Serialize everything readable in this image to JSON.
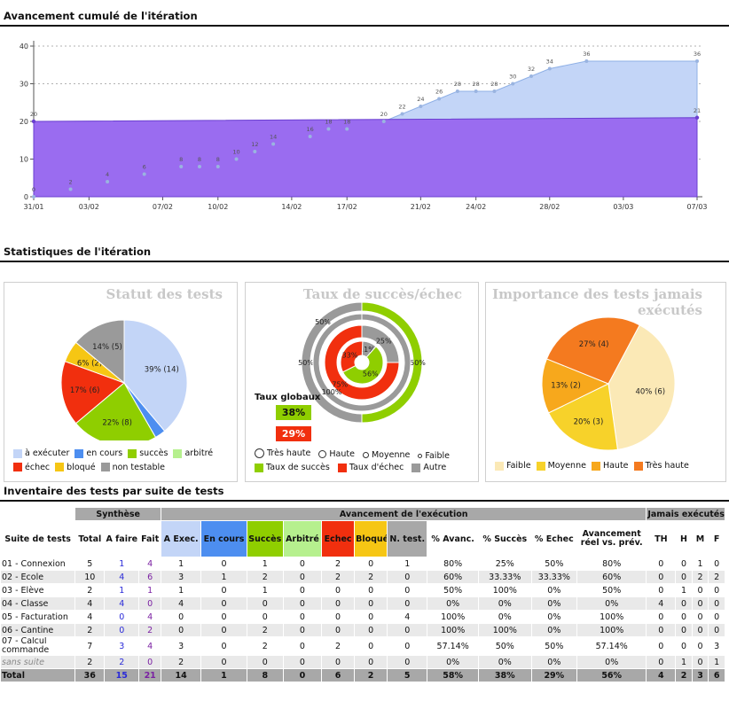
{
  "sections": {
    "cumulative_title": "Avancement cumulé de l'itération",
    "stats_title": "Statistiques de l'itération",
    "inventory_title": "Inventaire des tests par suite de tests"
  },
  "chart_data": [
    {
      "type": "area",
      "title": "Avancement cumulé de l'itération",
      "ylim": [
        0,
        40
      ],
      "yticks": [
        "0",
        "10",
        "20",
        "30",
        "40"
      ],
      "xticks": [
        "31/01",
        "03/02",
        "07/02",
        "10/02",
        "14/02",
        "17/02",
        "21/02",
        "24/02",
        "28/02",
        "03/03",
        "07/03"
      ],
      "grid": true,
      "colors": {
        "planned_fill": "#9a6cf0",
        "planned_line": "#6a3fd0",
        "actual_fill": "#c3d5f7",
        "actual_line": "#8fb0e6"
      },
      "series": [
        {
          "values": [
            {
              "x": "31/01",
              "y": 20
            },
            {
              "x": "07/03",
              "y": 21
            }
          ]
        },
        {
          "values": [
            {
              "x": "31/01",
              "y": 0
            },
            {
              "x": "02/02",
              "y": 2
            },
            {
              "x": "04/02",
              "y": 4
            },
            {
              "x": "06/02",
              "y": 6
            },
            {
              "x": "08/02",
              "y": 8
            },
            {
              "x": "09/02",
              "y": 8
            },
            {
              "x": "10/02",
              "y": 8
            },
            {
              "x": "11/02",
              "y": 10
            },
            {
              "x": "12/02",
              "y": 12
            },
            {
              "x": "13/02",
              "y": 14
            },
            {
              "x": "15/02",
              "y": 16
            },
            {
              "x": "16/02",
              "y": 18
            },
            {
              "x": "17/02",
              "y": 18
            },
            {
              "x": "19/02",
              "y": 20
            },
            {
              "x": "20/02",
              "y": 22
            },
            {
              "x": "21/02",
              "y": 24
            },
            {
              "x": "22/02",
              "y": 26
            },
            {
              "x": "23/02",
              "y": 28
            },
            {
              "x": "24/02",
              "y": 28
            },
            {
              "x": "25/02",
              "y": 28
            },
            {
              "x": "26/02",
              "y": 30
            },
            {
              "x": "27/02",
              "y": 32
            },
            {
              "x": "28/02",
              "y": 34
            },
            {
              "x": "01/03",
              "y": 36
            },
            {
              "x": "07/03",
              "y": 36
            }
          ]
        }
      ]
    },
    {
      "type": "pie",
      "title": "Statut des tests",
      "slices": [
        {
          "label": "39% (14)",
          "value": 14,
          "color": "#c3d5f7"
        },
        {
          "label": "",
          "value": 1,
          "color": "#4d8ef0"
        },
        {
          "label": "22% (8)",
          "value": 8,
          "color": "#8fce00"
        },
        {
          "label": "17% (6)",
          "value": 6,
          "color": "#f12f0e"
        },
        {
          "label": "6% (2)",
          "value": 2,
          "color": "#f6c614"
        },
        {
          "label": "14% (5)",
          "value": 5,
          "color": "#9a9a9a"
        }
      ],
      "legend": [
        {
          "label": "à exécuter",
          "color": "#c3d5f7"
        },
        {
          "label": "en cours",
          "color": "#4d8ef0"
        },
        {
          "label": "succès",
          "color": "#8fce00"
        },
        {
          "label": "arbitré",
          "color": "#b6f08e"
        },
        {
          "label": "échec",
          "color": "#f12f0e"
        },
        {
          "label": "bloqué",
          "color": "#f6c614"
        },
        {
          "label": "non testable",
          "color": "#9a9a9a"
        }
      ]
    },
    {
      "type": "pie",
      "title": "Taux de succès/échec",
      "rings": [
        {
          "name": "Très haute",
          "slices": [
            {
              "label": "50%",
              "value": 50,
              "color": "#8fce00"
            },
            {
              "label": "50%",
              "value": 50,
              "color": "#9a9a9a"
            }
          ]
        },
        {
          "name": "Haute",
          "slices": [
            {
              "label": "",
              "value": 100,
              "color": "#9a9a9a"
            }
          ]
        },
        {
          "name": "Moyenne",
          "slices": [
            {
              "label": "25%",
              "value": 25,
              "color": "#9a9a9a"
            },
            {
              "label": "75%",
              "value": 75,
              "color": "#f12f0e"
            }
          ]
        },
        {
          "name": "Faible",
          "slices": [
            {
              "label": "11%",
              "value": 11,
              "color": "#9a9a9a"
            },
            {
              "label": "56%",
              "value": 56,
              "color": "#8fce00"
            },
            {
              "label": "33%",
              "value": 33,
              "color": "#f12f0e"
            }
          ]
        }
      ],
      "outer_labels": [
        "50%",
        "100%"
      ],
      "global_title": "Taux globaux",
      "global_success": "38%",
      "global_fail": "29%",
      "legend_rings": [
        "Très haute",
        "Haute",
        "Moyenne",
        "Faible"
      ],
      "legend": [
        {
          "label": "Taux de succès",
          "color": "#8fce00"
        },
        {
          "label": "Taux d'échec",
          "color": "#f12f0e"
        },
        {
          "label": "Autre",
          "color": "#9a9a9a"
        }
      ]
    },
    {
      "type": "pie",
      "title_line1": "Importance des tests jamais",
      "title_line2": "exécutés",
      "slices": [
        {
          "label": "40% (6)",
          "value": 6,
          "color": "#fbe9b6"
        },
        {
          "label": "20% (3)",
          "value": 3,
          "color": "#f7d22a"
        },
        {
          "label": "13% (2)",
          "value": 2,
          "color": "#f7a81c"
        },
        {
          "label": "27% (4)",
          "value": 4,
          "color": "#f47a1f"
        }
      ],
      "legend": [
        {
          "label": "Faible",
          "color": "#fbe9b6"
        },
        {
          "label": "Moyenne",
          "color": "#f7d22a"
        },
        {
          "label": "Haute",
          "color": "#f7a81c"
        },
        {
          "label": "Très haute",
          "color": "#f47a1f"
        }
      ]
    }
  ],
  "table": {
    "groups": [
      "Synthèse",
      "Avancement de l'exécution",
      "Jamais exécutés"
    ],
    "headers": [
      "Suite de tests",
      "Total",
      "A faire",
      "Fait",
      "A Exec.",
      "En cours",
      "Succès",
      "Arbitré",
      "Echec",
      "Bloqué",
      "N. test.",
      "% Avanc.",
      "% Succès",
      "% Echec",
      "Avancement réel vs. prév.",
      "TH",
      "H",
      "M",
      "F"
    ],
    "header_colors": {
      "A Exec.": "#c3d5f7",
      "En cours": "#4d8ef0",
      "Succès": "#8fce00",
      "Arbitré": "#b6f08e",
      "Echec": "#f12f0e",
      "Bloqué": "#f6c614",
      "N. test.": "#a8a8a8"
    },
    "rows": [
      [
        "01 - Connexion",
        "5",
        "1",
        "4",
        "1",
        "0",
        "1",
        "0",
        "2",
        "0",
        "1",
        "80%",
        "25%",
        "50%",
        "80%",
        "0",
        "0",
        "1",
        "0"
      ],
      [
        "02 - Ecole",
        "10",
        "4",
        "6",
        "3",
        "1",
        "2",
        "0",
        "2",
        "2",
        "0",
        "60%",
        "33.33%",
        "33.33%",
        "60%",
        "0",
        "0",
        "2",
        "2"
      ],
      [
        "03 - Elève",
        "2",
        "1",
        "1",
        "1",
        "0",
        "1",
        "0",
        "0",
        "0",
        "0",
        "50%",
        "100%",
        "0%",
        "50%",
        "0",
        "1",
        "0",
        "0"
      ],
      [
        "04 - Classe",
        "4",
        "4",
        "0",
        "4",
        "0",
        "0",
        "0",
        "0",
        "0",
        "0",
        "0%",
        "0%",
        "0%",
        "0%",
        "4",
        "0",
        "0",
        "0"
      ],
      [
        "05 - Facturation",
        "4",
        "0",
        "4",
        "0",
        "0",
        "0",
        "0",
        "0",
        "0",
        "4",
        "100%",
        "0%",
        "0%",
        "100%",
        "0",
        "0",
        "0",
        "0"
      ],
      [
        "06 - Cantine",
        "2",
        "0",
        "2",
        "0",
        "0",
        "2",
        "0",
        "0",
        "0",
        "0",
        "100%",
        "100%",
        "0%",
        "100%",
        "0",
        "0",
        "0",
        "0"
      ],
      [
        "07 - Calcul commande",
        "7",
        "3",
        "4",
        "3",
        "0",
        "2",
        "0",
        "2",
        "0",
        "0",
        "57.14%",
        "50%",
        "50%",
        "57.14%",
        "0",
        "0",
        "0",
        "3"
      ],
      [
        "sans suite",
        "2",
        "2",
        "0",
        "2",
        "0",
        "0",
        "0",
        "0",
        "0",
        "0",
        "0%",
        "0%",
        "0%",
        "0%",
        "0",
        "1",
        "0",
        "1"
      ]
    ],
    "total": [
      "Total",
      "36",
      "15",
      "21",
      "14",
      "1",
      "8",
      "0",
      "6",
      "2",
      "5",
      "58%",
      "38%",
      "29%",
      "56%",
      "4",
      "2",
      "3",
      "6"
    ]
  }
}
